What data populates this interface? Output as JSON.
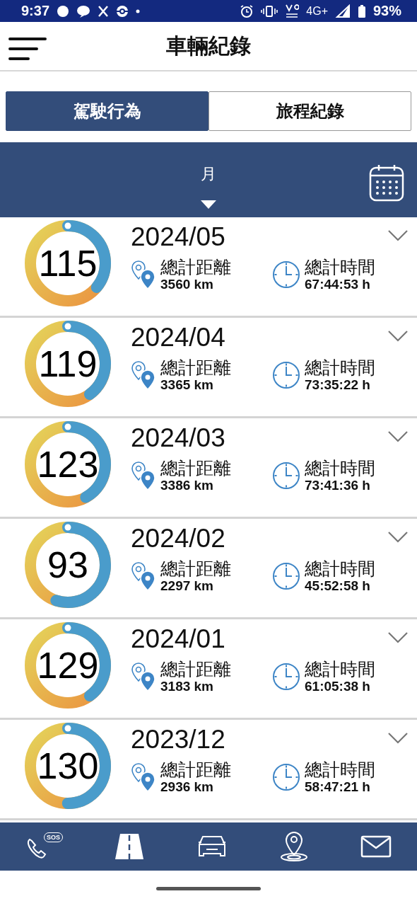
{
  "status_bar": {
    "time": "9:37",
    "network": "4G+",
    "battery": "93%"
  },
  "header": {
    "title": "車輛紀錄"
  },
  "tabs": [
    {
      "label": "駕駛行為",
      "selected": true
    },
    {
      "label": "旅程紀錄",
      "selected": false
    }
  ],
  "period": {
    "label": "月"
  },
  "records": [
    {
      "period": "2024/05",
      "score": "115",
      "level": 0.36,
      "distance_label": "總計距離",
      "distance": "3560 km",
      "time_label": "總計時間",
      "time": "67:44:53 h",
      "expanded": false
    },
    {
      "period": "2024/04",
      "score": "119",
      "level": 0.4,
      "distance_label": "總計距離",
      "distance": "3365 km",
      "time_label": "總計時間",
      "time": "73:35:22 h",
      "expanded": false
    },
    {
      "period": "2024/03",
      "score": "123",
      "level": 0.42,
      "distance_label": "總計距離",
      "distance": "3386 km",
      "time_label": "總計時間",
      "time": "73:41:36 h",
      "expanded": false
    },
    {
      "period": "2024/02",
      "score": "93",
      "level": 0.55,
      "distance_label": "總計距離",
      "distance": "2297 km",
      "time_label": "總計時間",
      "time": "45:52:58 h",
      "expanded": false
    },
    {
      "period": "2024/01",
      "score": "129",
      "level": 0.4,
      "distance_label": "總計距離",
      "distance": "3183 km",
      "time_label": "總計時間",
      "time": "61:05:38 h",
      "expanded": false
    },
    {
      "period": "2023/12",
      "score": "130",
      "level": 0.5,
      "distance_label": "總計距離",
      "distance": "2936 km",
      "time_label": "總計時間",
      "time": "58:47:21 h",
      "expanded": false
    }
  ],
  "nav": [
    {
      "kind": "sos",
      "label": "SOS"
    },
    {
      "kind": "road"
    },
    {
      "kind": "car"
    },
    {
      "kind": "location"
    },
    {
      "kind": "mail"
    }
  ]
}
